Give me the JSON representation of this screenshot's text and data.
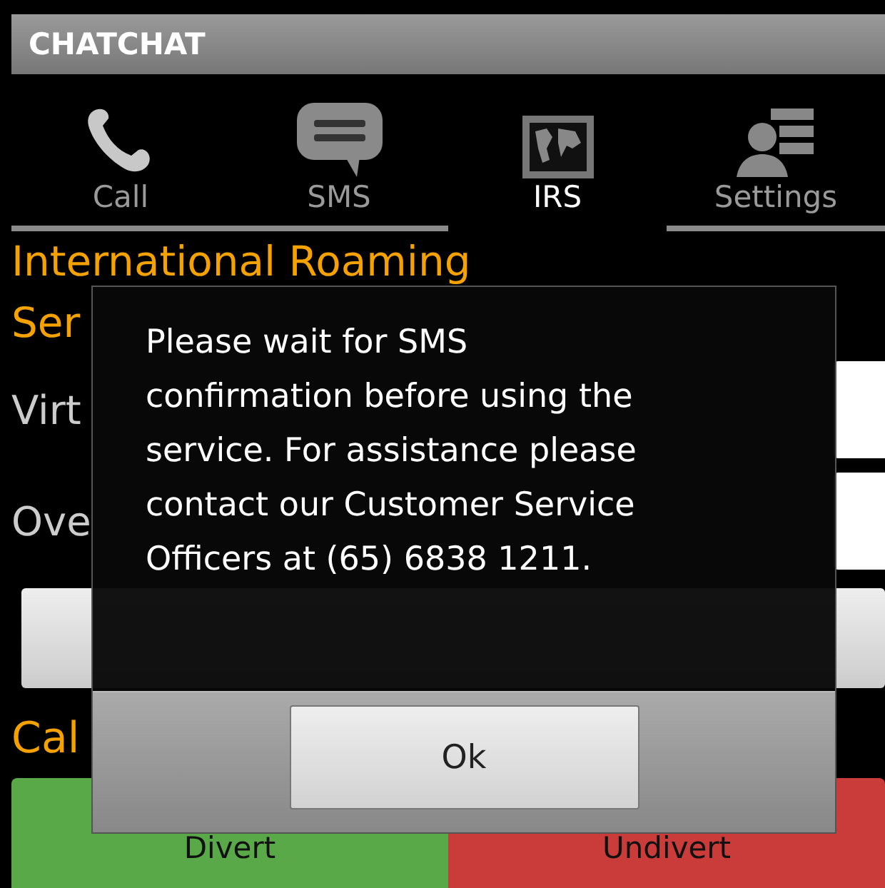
{
  "app_bar": {
    "title": "CHATCHAT"
  },
  "tabs": [
    {
      "label": "Call",
      "kind": "phone",
      "selected": false
    },
    {
      "label": "SMS",
      "kind": "chat",
      "selected": false
    },
    {
      "label": "IRS",
      "kind": "map",
      "selected": true
    },
    {
      "label": "Settings",
      "kind": "person",
      "selected": false
    }
  ],
  "section_heading": {
    "line_1": "International Roaming",
    "line_2": "Ser"
  },
  "fields": [
    {
      "label": "Virt"
    },
    {
      "label": "Ove"
    }
  ],
  "call_heading": "Cal",
  "call_buttons": [
    {
      "label": "Divert",
      "color": "#5aa948"
    },
    {
      "label": "Undivert",
      "color": "#c93c3a"
    }
  ],
  "dialog": {
    "message": "Please wait for SMS\nconfirmation before using the\nservice. For assistance please\ncontact our Customer Service\nOfficers at (65) 6838 1211.",
    "button": "Ok"
  }
}
